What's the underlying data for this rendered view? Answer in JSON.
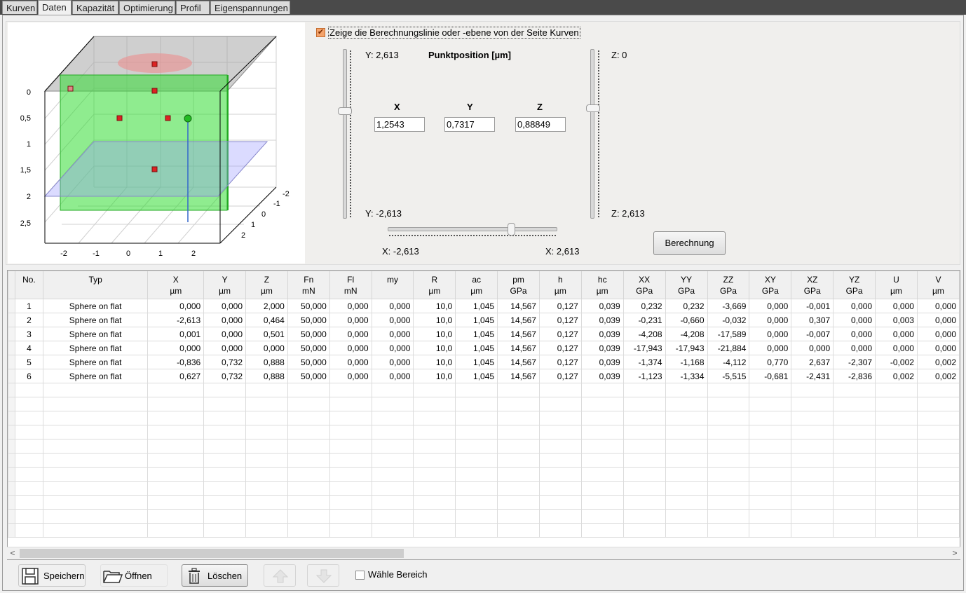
{
  "tabs": [
    "Kurven",
    "Daten",
    "Kapazität",
    "Optimierung",
    "Profil",
    "Eigenspannungen"
  ],
  "active_tab": "Daten",
  "controls": {
    "show_line_label": "Zeige die Berechnungslinie oder -ebene von der Seite Kurven",
    "show_line_checked": true,
    "y_top": "Y: 2,613",
    "y_bottom": "Y: -2,613",
    "z_top": "Z: 0",
    "z_bottom": "Z: 2,613",
    "x_left": "X: -2,613",
    "x_right": "X: 2,613",
    "point_title": "Punktposition [µm]",
    "x_label": "X",
    "y_label": "Y",
    "z_label": "Z",
    "x_value": "1,2543",
    "y_value": "0,7317",
    "z_value": "0,88849",
    "y_slider_fraction": 0.36,
    "z_slider_fraction": 0.34,
    "x_slider_fraction": 0.74,
    "calc_button": "Berechnung"
  },
  "plot": {
    "y_ticks": [
      "0",
      "0,5",
      "1",
      "1,5",
      "2",
      "2,5"
    ],
    "x_ticks": [
      "-2",
      "-1",
      "0",
      "1",
      "2"
    ],
    "z_ticks": [
      "-2",
      "-1",
      "0",
      "1",
      "2"
    ],
    "colors": {
      "green_box": "#33dd33",
      "gray_plane": "#a0a0a0",
      "blue_plane": "#8888ff",
      "point": "#dd2222",
      "active_point": "#22bb22"
    }
  },
  "table": {
    "columns": [
      {
        "name": "No.",
        "unit": ""
      },
      {
        "name": "Typ",
        "unit": ""
      },
      {
        "name": "X",
        "unit": "µm"
      },
      {
        "name": "Y",
        "unit": "µm"
      },
      {
        "name": "Z",
        "unit": "µm"
      },
      {
        "name": "Fn",
        "unit": "mN"
      },
      {
        "name": "Fl",
        "unit": "mN"
      },
      {
        "name": "my",
        "unit": ""
      },
      {
        "name": "R",
        "unit": "µm"
      },
      {
        "name": "ac",
        "unit": "µm"
      },
      {
        "name": "pm",
        "unit": "GPa"
      },
      {
        "name": "h",
        "unit": "µm"
      },
      {
        "name": "hc",
        "unit": "µm"
      },
      {
        "name": "XX",
        "unit": "GPa"
      },
      {
        "name": "YY",
        "unit": "GPa"
      },
      {
        "name": "ZZ",
        "unit": "GPa"
      },
      {
        "name": "XY",
        "unit": "GPa"
      },
      {
        "name": "XZ",
        "unit": "GPa"
      },
      {
        "name": "YZ",
        "unit": "GPa"
      },
      {
        "name": "U",
        "unit": "µm"
      },
      {
        "name": "V",
        "unit": "µm"
      }
    ],
    "rows": [
      [
        "1",
        "Sphere on flat",
        "0,000",
        "0,000",
        "2,000",
        "50,000",
        "0,000",
        "0,000",
        "10,0",
        "1,045",
        "14,567",
        "0,127",
        "0,039",
        "0,232",
        "0,232",
        "-3,669",
        "0,000",
        "-0,001",
        "0,000",
        "0,000",
        "0,000"
      ],
      [
        "2",
        "Sphere on flat",
        "-2,613",
        "0,000",
        "0,464",
        "50,000",
        "0,000",
        "0,000",
        "10,0",
        "1,045",
        "14,567",
        "0,127",
        "0,039",
        "-0,231",
        "-0,660",
        "-0,032",
        "0,000",
        "0,307",
        "0,000",
        "0,003",
        "0,000"
      ],
      [
        "3",
        "Sphere on flat",
        "0,001",
        "0,000",
        "0,501",
        "50,000",
        "0,000",
        "0,000",
        "10,0",
        "1,045",
        "14,567",
        "0,127",
        "0,039",
        "-4,208",
        "-4,208",
        "-17,589",
        "0,000",
        "-0,007",
        "0,000",
        "0,000",
        "0,000"
      ],
      [
        "4",
        "Sphere on flat",
        "0,000",
        "0,000",
        "0,000",
        "50,000",
        "0,000",
        "0,000",
        "10,0",
        "1,045",
        "14,567",
        "0,127",
        "0,039",
        "-17,943",
        "-17,943",
        "-21,884",
        "0,000",
        "0,000",
        "0,000",
        "0,000",
        "0,000"
      ],
      [
        "5",
        "Sphere on flat",
        "-0,836",
        "0,732",
        "0,888",
        "50,000",
        "0,000",
        "0,000",
        "10,0",
        "1,045",
        "14,567",
        "0,127",
        "0,039",
        "-1,374",
        "-1,168",
        "-4,112",
        "0,770",
        "2,637",
        "-2,307",
        "-0,002",
        "0,002"
      ],
      [
        "6",
        "Sphere on flat",
        "0,627",
        "0,732",
        "0,888",
        "50,000",
        "0,000",
        "0,000",
        "10,0",
        "1,045",
        "14,567",
        "0,127",
        "0,039",
        "-1,123",
        "-1,334",
        "-5,515",
        "-0,681",
        "-2,431",
        "-2,836",
        "0,002",
        "0,002"
      ]
    ]
  },
  "bottom": {
    "save": "Speichern",
    "open": "Öffnen",
    "delete": "Löschen",
    "select_range": "Wähle Bereich"
  }
}
